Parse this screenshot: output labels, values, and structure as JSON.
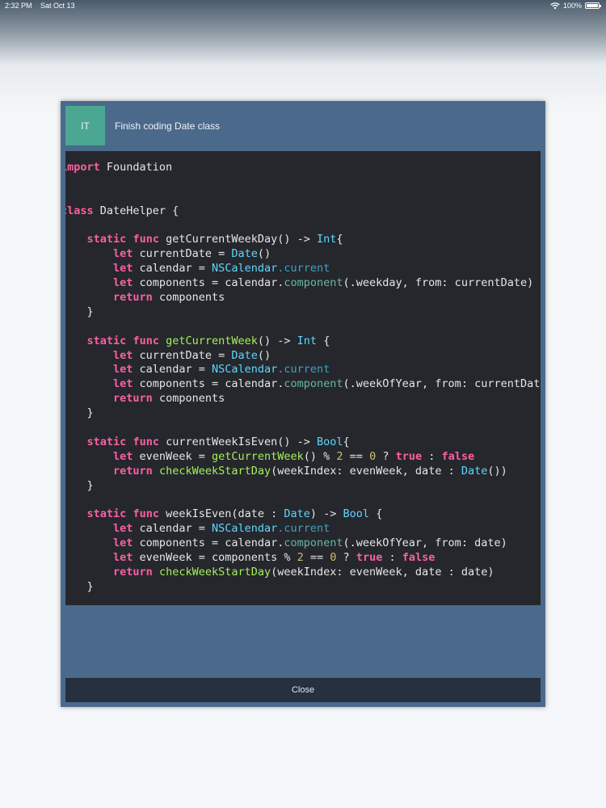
{
  "status_bar": {
    "time": "2:32 PM",
    "date": "Sat Oct 13",
    "battery": "100%",
    "battery_level": 1.0,
    "icons": [
      "wifi-icon",
      "battery-icon"
    ]
  },
  "modal": {
    "avatar_initials": "IT",
    "title": "Finish coding Date class",
    "close_label": "Close",
    "colors": {
      "panel": "#4b6a8b",
      "avatar": "#4ba791",
      "code_background": "#25272c",
      "close_bar": "#26303f"
    }
  },
  "code": {
    "lines": [
      "import Foundation",
      "",
      "",
      "class DateHelper {",
      "",
      "    static func getCurrentWeekDay() -> Int{",
      "        let currentDate = Date()",
      "        let calendar = NSCalendar.current",
      "        let components = calendar.component(.weekday, from: currentDate)",
      "        return components",
      "    }",
      "",
      "    static func getCurrentWeek() -> Int {",
      "        let currentDate = Date()",
      "        let calendar = NSCalendar.current",
      "        let components = calendar.component(.weekOfYear, from: currentDate)",
      "        return components",
      "    }",
      "",
      "    static func currentWeekIsEven() -> Bool{",
      "        let evenWeek = getCurrentWeek() % 2 == 0 ? true : false",
      "        return checkWeekStartDay(weekIndex: evenWeek, date : Date())",
      "    }",
      "",
      "    static func weekIsEven(date : Date) -> Bool {",
      "        let calendar = NSCalendar.current",
      "        let components = calendar.component(.weekOfYear, from: date)",
      "        let evenWeek = components % 2 == 0 ? true : false",
      "        return checkWeekStartDay(weekIndex: evenWeek, date : date)",
      "    }"
    ]
  }
}
